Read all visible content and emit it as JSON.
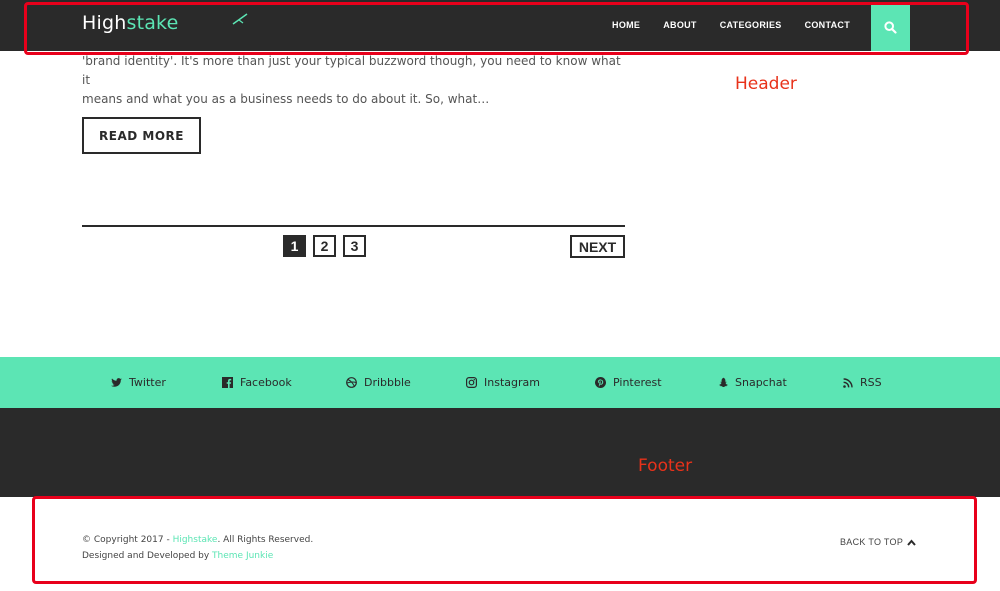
{
  "header": {
    "logo_part1": "High",
    "logo_part2": "stake",
    "nav": [
      "HOME",
      "ABOUT",
      "CATEGORIES",
      "CONTACT"
    ],
    "search_icon": "search-icon",
    "annotation": "Header"
  },
  "post": {
    "excerpt_line1": "'brand identity'. It's more than just your typical buzzword though, you need to know what it",
    "excerpt_line2": "means and what you as a business needs to do about it. So, what…",
    "read_more": "READ MORE"
  },
  "pagination": {
    "pages": [
      "1",
      "2",
      "3"
    ],
    "current": "1",
    "next": "NEXT"
  },
  "social": [
    {
      "label": "Twitter",
      "icon": "twitter-icon"
    },
    {
      "label": "Facebook",
      "icon": "facebook-icon"
    },
    {
      "label": "Dribbble",
      "icon": "dribbble-icon"
    },
    {
      "label": "Instagram",
      "icon": "instagram-icon"
    },
    {
      "label": "Pinterest",
      "icon": "pinterest-icon"
    },
    {
      "label": "Snapchat",
      "icon": "snapchat-icon"
    },
    {
      "label": "RSS",
      "icon": "rss-icon"
    }
  ],
  "footer": {
    "annotation": "Footer",
    "copyright_prefix": "© Copyright 2017 - ",
    "copyright_link": "Highstake",
    "copyright_suffix": ". All Rights Reserved.",
    "designed_prefix": "Designed and Developed by ",
    "designed_link": "Theme Junkie",
    "back_to_top": "BACK TO TOP"
  },
  "colors": {
    "accent": "#5ce5b4",
    "dark": "#2a2a2a",
    "annotation_red": "#e8001b"
  }
}
